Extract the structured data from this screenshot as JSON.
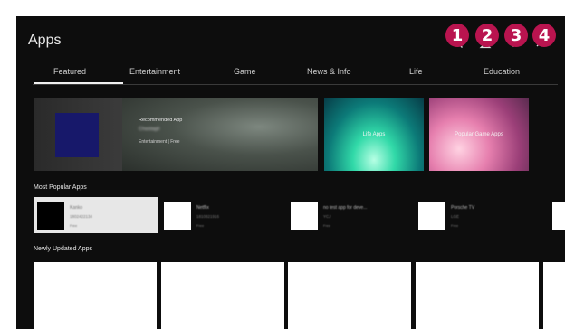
{
  "header": {
    "title": "Apps"
  },
  "toolbar": {
    "icons": [
      {
        "name": "search-icon",
        "badge": "1"
      },
      {
        "name": "account-icon",
        "badge": "2"
      },
      {
        "name": "more-options-icon",
        "badge": "3"
      },
      {
        "name": "close-icon",
        "badge": "4"
      }
    ]
  },
  "tabs": [
    "Featured",
    "Entertainment",
    "Game",
    "News & Info",
    "Life",
    "Education"
  ],
  "banners": {
    "recommended": {
      "label": "Recommended App",
      "app_name": "Chastagit",
      "meta": "Entertainment | Free"
    },
    "life": "Life Apps",
    "game": "Popular Game Apps"
  },
  "sections": {
    "most_popular": "Most Popular Apps",
    "newly_updated": "Newly Updated Apps"
  },
  "popular_apps": [
    {
      "name": "Kanko",
      "developer": "1802422134",
      "price": "Free"
    },
    {
      "name": "Netflix",
      "developer": "1810821916",
      "price": "Free"
    },
    {
      "name": "no test app for deve...",
      "developer": "YCJ",
      "price": "Free"
    },
    {
      "name": "Porsche TV",
      "developer": "LGE",
      "price": "Free"
    }
  ],
  "colors": {
    "badge": "#b9144f",
    "background": "#0d0d0d"
  }
}
